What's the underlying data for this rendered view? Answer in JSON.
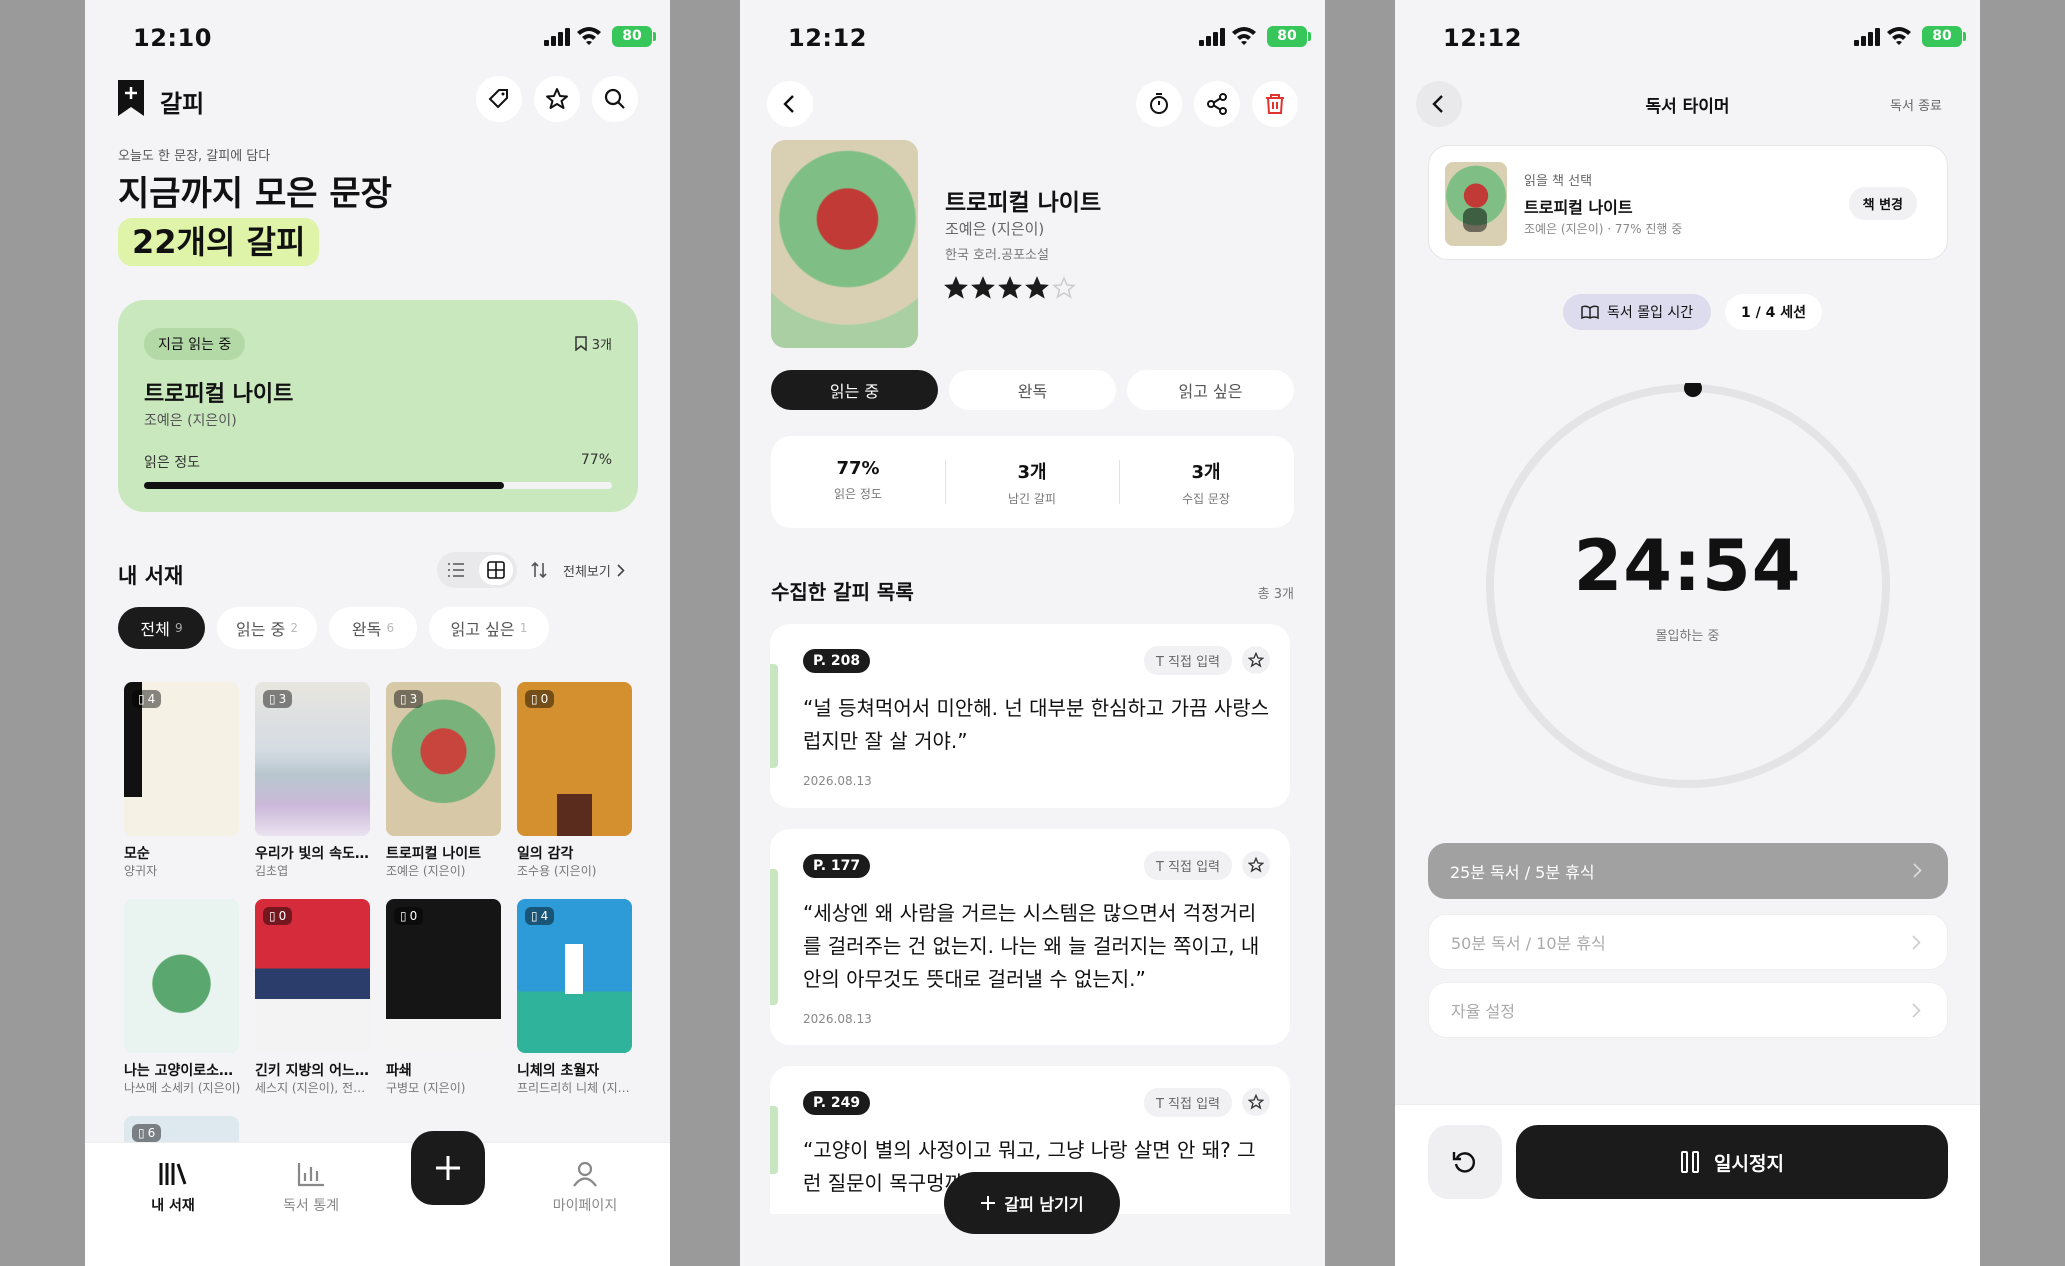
{
  "status": {
    "time1": "12:10",
    "time2": "12:12",
    "time3": "12:12",
    "battery": "80"
  },
  "home": {
    "brand": "갈피",
    "subtitle": "오늘도 한 문장, 갈피에 담다",
    "heading": "지금까지 모은 문장",
    "count_label": "22개의 갈피",
    "current": {
      "tag": "지금 읽는 중",
      "bookmarks": "3개",
      "title": "트로피컬 나이트",
      "author": "조예은 (지은이)",
      "progress_label": "읽은 정도",
      "progress_pct": "77%",
      "progress": 0.77
    },
    "shelf_title": "내 서재",
    "view_all": "전체보기",
    "filters": [
      {
        "label": "전체",
        "count": "9"
      },
      {
        "label": "읽는 중",
        "count": "2"
      },
      {
        "label": "완독",
        "count": "6"
      },
      {
        "label": "읽고 싶은",
        "count": "1"
      }
    ],
    "books": [
      {
        "title": "모순",
        "author": "양귀자",
        "badge": "4"
      },
      {
        "title": "우리가 빛의 속도로 갈 수 없다면",
        "author": "김초엽",
        "badge": "3"
      },
      {
        "title": "트로피컬 나이트",
        "author": "조예은 (지은이)",
        "badge": "3"
      },
      {
        "title": "일의 감각",
        "author": "조수용 (지은이)",
        "badge": "0"
      },
      {
        "title": "나는 고양이로소이다",
        "author": "나쓰메 소세키 (지은이)",
        "badge": ""
      },
      {
        "title": "긴키 지방의 어느 장소에 대하여",
        "author": "세스지 (지은이), 전선영",
        "badge": "0"
      },
      {
        "title": "파쇄",
        "author": "구병모 (지은이)",
        "badge": "0"
      },
      {
        "title": "니체의 초월자",
        "author": "프리드리히 니체 (지은이)",
        "badge": "4"
      }
    ],
    "extra_badge": "6",
    "nav": [
      {
        "label": "내 서재"
      },
      {
        "label": "독서 통계"
      },
      {
        "label": "마이페이지"
      }
    ]
  },
  "detail": {
    "title": "트로피컬 나이트",
    "author": "조예은 (지은이)",
    "genre": "한국 호러.공포소설",
    "rating": 4,
    "status_tabs": [
      "읽는 중",
      "완독",
      "읽고 싶은"
    ],
    "stats": [
      {
        "value": "77%",
        "label": "읽은 정도"
      },
      {
        "value": "3개",
        "label": "남긴 갈피"
      },
      {
        "value": "3개",
        "label": "수집 문장"
      }
    ],
    "list_title": "수집한 갈피 목록",
    "list_count": "총 3개",
    "input_label": "직접 입력",
    "quotes": [
      {
        "page": "P. 208",
        "text": "“널 등쳐먹어서 미안해. 넌 대부분 한심하고 가끔 사랑스럽지만 잘 살 거야.”",
        "date": "2026.08.13"
      },
      {
        "page": "P. 177",
        "text": "“세상엔 왜 사람을 거르는 시스템은 많으면서 걱정거리를 걸러주는 건 없는지. 나는 왜 늘 걸러지는 쪽이고, 내 안의 아무것도 뜻대로 걸러낼 수 없는지.”",
        "date": "2026.08.13"
      },
      {
        "page": "P. 249",
        "text": "“고양이 별의 사정이고 뭐고, 그냥 나랑 살면 안 돼? 그런 질문이 목구멍까지 차올랐다.”",
        "date": ""
      }
    ],
    "fab": "갈피 남기기"
  },
  "timer": {
    "title": "독서 타이머",
    "end": "독서 종료",
    "select_label": "읽을 책 선택",
    "book_title": "트로피컬 나이트",
    "book_meta": "조예은 (지은이) · 77% 진행 중",
    "change": "책 변경",
    "mode": "독서 몰입 시간",
    "session": "1 / 4 세션",
    "time": "24:54",
    "state": "몰입하는 중",
    "elapsed_fraction": 0.004,
    "presets": [
      "25분 독서 / 5분 휴식",
      "50분 독서 / 10분 휴식",
      "자율 설정"
    ],
    "pause": "일시정지"
  }
}
